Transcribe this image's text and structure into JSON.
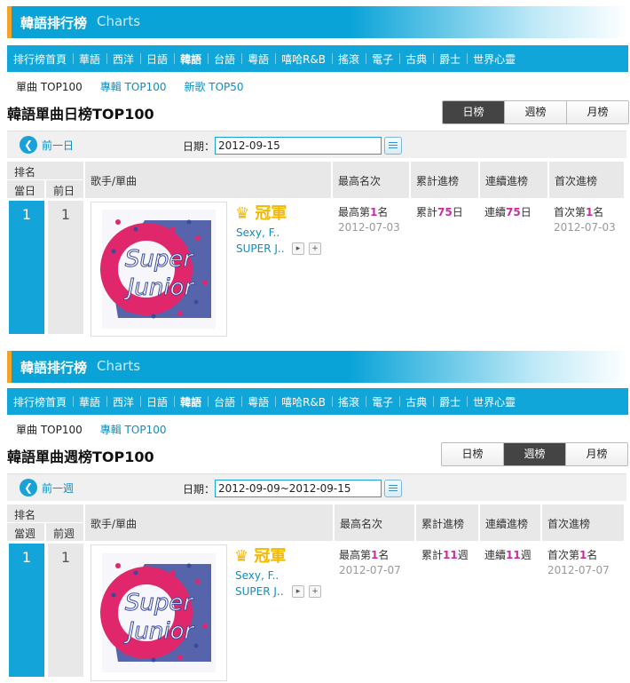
{
  "colors": {
    "accent": "#13a5d9",
    "orange": "#f2a32a",
    "highlight": "#cc2ba0",
    "crown": "#f5b800"
  },
  "banner": {
    "title": "韓語排行榜",
    "subtitle": "Charts"
  },
  "nav": [
    "排行榜首頁",
    "華語",
    "西洋",
    "日語",
    "韓語",
    "台語",
    "粵語",
    "嘻哈R&B",
    "搖滾",
    "電子",
    "古典",
    "爵士",
    "世界心靈"
  ],
  "nav_active": "韓語",
  "daily": {
    "subtabs": [
      "單曲 TOP100",
      "專輯 TOP100",
      "新歌 TOP50"
    ],
    "page_title": "韓語單曲日榜TOP100",
    "segments": [
      "日榜",
      "週榜",
      "月榜"
    ],
    "active_segment": "日榜",
    "prev_label": "前一日",
    "date_label": "日期：",
    "date_value": "2012-09-15",
    "headers": {
      "rank": "排名",
      "cur": "當日",
      "prev": "前日",
      "artist_song": "歌手/單曲",
      "peak": "最高名次",
      "total": "累計進榜",
      "consec": "連續進榜",
      "first": "首次進榜"
    },
    "row": {
      "cur_rank": "1",
      "prev_rank": "1",
      "crown": "冠軍",
      "song": "Sexy, F..",
      "artist": "SUPER J..",
      "peak_pre": "最高第",
      "peak_num": "1",
      "peak_post": "名",
      "peak_date": "2012-07-03",
      "total_pre": "累計",
      "total_num": "75",
      "total_post": "日",
      "consec_pre": "連續",
      "consec_num": "75",
      "consec_post": "日",
      "first_pre": "首次第",
      "first_num": "1",
      "first_post": "名",
      "first_date": "2012-07-03"
    }
  },
  "weekly": {
    "subtabs": [
      "單曲 TOP100",
      "專輯 TOP100"
    ],
    "page_title": "韓語單曲週榜TOP100",
    "segments": [
      "日榜",
      "週榜",
      "月榜"
    ],
    "active_segment": "週榜",
    "prev_label": "前一週",
    "date_label": "日期：",
    "date_value": "2012-09-09~2012-09-15",
    "headers": {
      "rank": "排名",
      "cur": "當週",
      "prev": "前週",
      "artist_song": "歌手/單曲",
      "peak": "最高名次",
      "total": "累計進榜",
      "consec": "連續進榜",
      "first": "首次進榜"
    },
    "row": {
      "cur_rank": "1",
      "prev_rank": "1",
      "crown": "冠軍",
      "song": "Sexy, F..",
      "artist": "SUPER J..",
      "peak_pre": "最高第",
      "peak_num": "1",
      "peak_post": "名",
      "peak_date": "2012-07-07",
      "total_pre": "累計",
      "total_num": "11",
      "total_post": "週",
      "consec_pre": "連續",
      "consec_num": "11",
      "consec_post": "週",
      "first_pre": "首次第",
      "first_num": "1",
      "first_post": "名",
      "first_date": "2012-07-07"
    }
  },
  "cover_text": [
    "Super",
    "Junior"
  ]
}
